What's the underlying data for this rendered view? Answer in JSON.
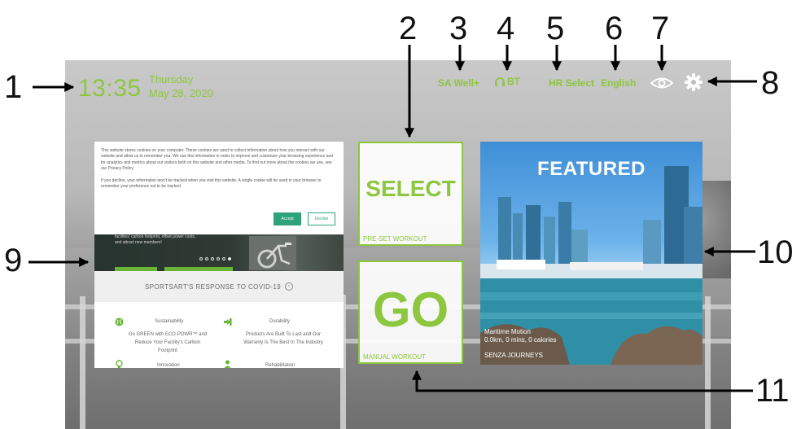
{
  "header": {
    "time": "13:35",
    "day": "Thursday",
    "date": "May 28, 2020",
    "sa_well": "SA Well+",
    "bt": "BT",
    "hr_select": "HR Select",
    "language": "English",
    "icons": [
      "headphones-icon",
      "eye-icon",
      "gear-icon"
    ]
  },
  "cookie": {
    "text1": "This website stores cookies on your computer. These cookies are used to collect information about how you interact with our website and allow us to remember you. We use this information in order to improve and customize your browsing experience and for analytics and metrics about our visitors both on this website and other media. To find out more about the cookies we use, see our Privacy Policy.",
    "text2": "If you decline, your information won't be tracked when you visit this website. A single cookie will be used in your browser to remember your preference not to be tracked.",
    "accept": "Accept",
    "decline": "Decline"
  },
  "hero": {
    "text": "facilities' carbon footprint, offset power costs, and attract new members!"
  },
  "covid": {
    "label": "SPORTSART'S RESPONSE TO COVID-19",
    "arrow": "›"
  },
  "features": [
    {
      "title": "Sustainability",
      "desc": "Go GREEN with ECO-POWR™ and Reduce Your Facility's Carbon Footprint",
      "icon": "globe-icon"
    },
    {
      "title": "Durability",
      "desc": "Products Are Built To Last and Our Warranty Is The Best In The Industry",
      "icon": "sign-in-icon"
    },
    {
      "title": "Innovation",
      "icon": "lightbulb-icon"
    },
    {
      "title": "Rehabilitation",
      "icon": "person-icon"
    }
  ],
  "tiles": {
    "select_label": "SELECT",
    "select_sub": "PRE-SET WORKOUT",
    "go_label": "GO",
    "go_sub": "MANUAL WORKOUT"
  },
  "featured": {
    "heading": "FEATURED",
    "title": "Maritime Motion",
    "stats": "0.0km, 0 mins, 0 calories",
    "provider": "SENZA JOURNEYS"
  },
  "callouts": [
    "1",
    "2",
    "3",
    "4",
    "5",
    "6",
    "7",
    "8",
    "9",
    "10",
    "11"
  ],
  "colors": {
    "accent": "#8dc63f",
    "cookie_button": "#2fa27b",
    "hero_bar": "#69b536"
  }
}
